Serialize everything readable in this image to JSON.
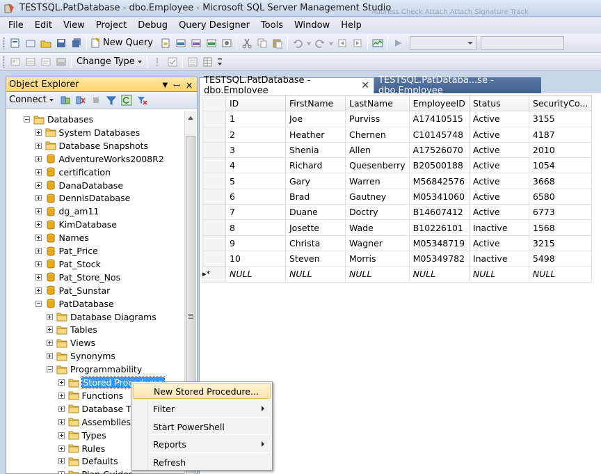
{
  "window": {
    "title": "TESTSQL.PatDatabase - dbo.Employee - Microsoft SQL Server Management Studio",
    "ghost_text": "Address Check  Attach  Attach Signature  Track"
  },
  "menu": [
    "File",
    "Edit",
    "View",
    "Project",
    "Debug",
    "Query Designer",
    "Tools",
    "Window",
    "Help"
  ],
  "toolbar": {
    "new_query_label": "New Query",
    "change_type_label": "Change Type"
  },
  "object_explorer": {
    "title": "Object Explorer",
    "pin_glyph": "▾ 井 ✕",
    "connect_label": "Connect",
    "tree": [
      {
        "label": "Databases",
        "level": 0,
        "state": "expanded",
        "icon": "folder"
      },
      {
        "label": "System Databases",
        "level": 1,
        "state": "collapsed",
        "icon": "folder"
      },
      {
        "label": "Database Snapshots",
        "level": 1,
        "state": "collapsed",
        "icon": "folder"
      },
      {
        "label": "AdventureWorks2008R2",
        "level": 1,
        "state": "collapsed",
        "icon": "database"
      },
      {
        "label": "certification",
        "level": 1,
        "state": "collapsed",
        "icon": "database"
      },
      {
        "label": "DanaDatabase",
        "level": 1,
        "state": "collapsed",
        "icon": "database"
      },
      {
        "label": "DennisDatabase",
        "level": 1,
        "state": "collapsed",
        "icon": "database"
      },
      {
        "label": "dg_am11",
        "level": 1,
        "state": "collapsed",
        "icon": "database"
      },
      {
        "label": "KimDatabase",
        "level": 1,
        "state": "collapsed",
        "icon": "database"
      },
      {
        "label": "Names",
        "level": 1,
        "state": "collapsed",
        "icon": "database"
      },
      {
        "label": "Pat_Price",
        "level": 1,
        "state": "collapsed",
        "icon": "database"
      },
      {
        "label": "Pat_Stock",
        "level": 1,
        "state": "collapsed",
        "icon": "database"
      },
      {
        "label": "Pat_Store_Nos",
        "level": 1,
        "state": "collapsed",
        "icon": "database"
      },
      {
        "label": "Pat_Sunstar",
        "level": 1,
        "state": "collapsed",
        "icon": "database"
      },
      {
        "label": "PatDatabase",
        "level": 1,
        "state": "expanded",
        "icon": "database"
      },
      {
        "label": "Database Diagrams",
        "level": 2,
        "state": "collapsed",
        "icon": "folder"
      },
      {
        "label": "Tables",
        "level": 2,
        "state": "collapsed",
        "icon": "folder"
      },
      {
        "label": "Views",
        "level": 2,
        "state": "collapsed",
        "icon": "folder"
      },
      {
        "label": "Synonyms",
        "level": 2,
        "state": "collapsed",
        "icon": "folder"
      },
      {
        "label": "Programmability",
        "level": 2,
        "state": "expanded",
        "icon": "folder"
      },
      {
        "label": "Stored Procedures",
        "level": 3,
        "state": "collapsed",
        "icon": "folder",
        "selected": true
      },
      {
        "label": "Functions",
        "level": 3,
        "state": "collapsed",
        "icon": "folder"
      },
      {
        "label": "Database Triggers",
        "level": 3,
        "state": "collapsed",
        "icon": "folder"
      },
      {
        "label": "Assemblies",
        "level": 3,
        "state": "collapsed",
        "icon": "folder"
      },
      {
        "label": "Types",
        "level": 3,
        "state": "collapsed",
        "icon": "folder"
      },
      {
        "label": "Rules",
        "level": 3,
        "state": "collapsed",
        "icon": "folder"
      },
      {
        "label": "Defaults",
        "level": 3,
        "state": "collapsed",
        "icon": "folder"
      },
      {
        "label": "Plan Guides",
        "level": 3,
        "state": "collapsed",
        "icon": "folder"
      }
    ]
  },
  "tabs": [
    {
      "label": "TESTSQL.PatDatabase - dbo.Employee",
      "active": true,
      "close": "✕"
    },
    {
      "label": "TESTSQL.PatDataba...se - dbo.Employee",
      "active": false
    }
  ],
  "grid": {
    "columns": [
      "ID",
      "FirstName",
      "LastName",
      "EmployeeID",
      "Status",
      "SecurityCo..."
    ],
    "rows": [
      [
        "1",
        "Joe",
        "Purviss",
        "A17410515",
        "Active",
        "3155"
      ],
      [
        "2",
        "Heather",
        "Chernen",
        "C10145748",
        "Active",
        "4187"
      ],
      [
        "3",
        "Shenia",
        "Allen",
        "A17526070",
        "Active",
        "2010"
      ],
      [
        "4",
        "Richard",
        "Quesenberry",
        "B20500188",
        "Active",
        "1054"
      ],
      [
        "5",
        "Gary",
        "Warren",
        "M56842576",
        "Active",
        "3668"
      ],
      [
        "6",
        "Brad",
        "Gautney",
        "M05341060",
        "Active",
        "6580"
      ],
      [
        "7",
        "Duane",
        "Doctry",
        "B14607412",
        "Active",
        "6773"
      ],
      [
        "8",
        "Josette",
        "Wade",
        "B10226101",
        "Inactive",
        "1568"
      ],
      [
        "9",
        "Christa",
        "Wagner",
        "M05348719",
        "Active",
        "3215"
      ],
      [
        "10",
        "Steven",
        "Morris",
        "M05349782",
        "Inactive",
        "5498"
      ]
    ],
    "new_row_marker": "▸*",
    "new_row": [
      "NULL",
      "NULL",
      "NULL",
      "NULL",
      "NULL",
      "NULL"
    ]
  },
  "context_menu": {
    "items": [
      {
        "label": "New Stored Procedure...",
        "highlighted": true,
        "submenu": false
      },
      {
        "label": "Filter",
        "submenu": true
      },
      {
        "label": "Start PowerShell",
        "submenu": false
      },
      {
        "label": "Reports",
        "submenu": true
      },
      {
        "label": "Refresh",
        "submenu": false
      }
    ]
  },
  "colors": {
    "selection": "#3399ff",
    "panel_header": "#ffd46a",
    "inactive_tab": "#40608f"
  }
}
